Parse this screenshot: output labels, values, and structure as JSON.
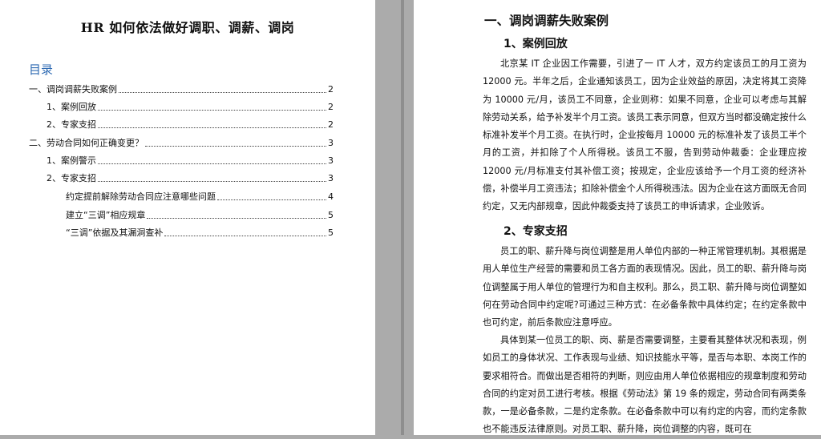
{
  "left_page": {
    "title": "HR 如何依法做好调职、调薪、调岗",
    "toc_heading": "目录",
    "toc": [
      {
        "label": "一、调岗调薪失败案例",
        "page": "2"
      },
      {
        "label": "1、案例回放",
        "page": "2"
      },
      {
        "label": "2、专家支招",
        "page": "2"
      },
      {
        "label": "二、劳动合同如何正确变更？",
        "page": "3"
      },
      {
        "label": "1、案例警示",
        "page": "3"
      },
      {
        "label": "2、专家支招",
        "page": "3"
      },
      {
        "label": "约定提前解除劳动合同应注意哪些问题",
        "page": "4"
      },
      {
        "label": "建立“三调”相应规章",
        "page": "5"
      },
      {
        "label": "“三调”依据及其漏洞查补",
        "page": "5"
      }
    ]
  },
  "right_page": {
    "heading1": "一、调岗调薪失败案例",
    "sub1": "1、案例回放",
    "para1": "北京某 IT 企业因工作需要，引进了一 IT 人才，双方约定该员工的月工资为 12000 元。半年之后，企业通知该员工，因为企业效益的原因，决定将其工资降为 10000 元/月，该员工不同意，企业则称：如果不同意，企业可以考虑与其解除劳动关系，给予补发半个月工资。该员工表示同意，但双方当时都没确定按什么标准补发半个月工资。在执行时，企业按每月 10000 元的标准补发了该员工半个月的工资，并扣除了个人所得税。该员工不服，告到劳动仲裁委：企业理应按 12000 元/月标准支付其补偿工资；按规定，企业应该给予一个月工资的经济补偿，补偿半月工资违法；扣除补偿金个人所得税违法。因为企业在这方面既无合同约定，又无内部规章，因此仲裁委支持了该员工的申诉请求，企业败诉。",
    "sub2": "2、专家支招",
    "para2": "员工的职、薪升降与岗位调整是用人单位内部的一种正常管理机制。其根据是用人单位生产经营的需要和员工各方面的表现情况。因此，员工的职、薪升降与岗位调整属于用人单位的管理行为和自主权利。那么，员工职、薪升降与岗位调整如何在劳动合同中约定呢?可通过三种方式：在必备条款中具体约定；在约定条款中也可约定，前后条款应注意呼应。",
    "para3": "具体到某一位员工的职、岗、薪是否需要调整，主要看其整体状况和表现，例如员工的身体状况、工作表现与业绩、知识技能水平等，是否与本职、本岗工作的要求相符合。而做出是否相符的判断，则应由用人单位依据相应的规章制度和劳动合同的约定对员工进行考核。根据《劳动法》第 19 条的规定，劳动合同有两类条款，一是必备条款，二是约定条款。在必备条款中可以有约定的内容，而约定条款也不能违反法律原则。对员工职、薪升降，岗位调整的内容，既可在"
  }
}
